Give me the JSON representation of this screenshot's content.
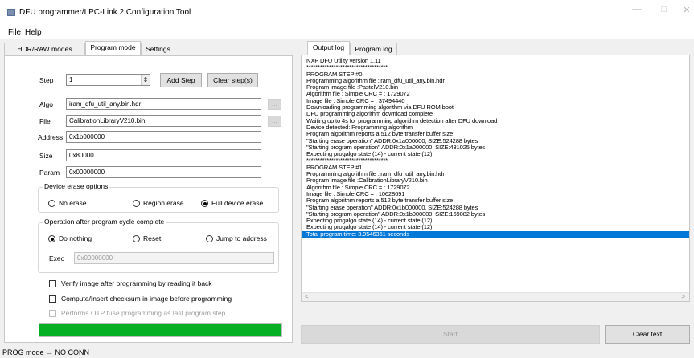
{
  "window": {
    "title": "DFU programmer/LPC-Link 2 Configuration Tool",
    "minimize": "—",
    "maximize": "□",
    "close": "✕"
  },
  "menu": [
    "File",
    "Help"
  ],
  "left_tabs": [
    "HDR/RAW modes",
    "Program mode",
    "Settings"
  ],
  "step": {
    "label": "Step",
    "value": "1",
    "spinner": "⇕",
    "add": "Add Step",
    "clear": "Clear step(s)"
  },
  "fields": {
    "algo": {
      "label": "Algo",
      "value": "iram_dfu_util_any.bin.hdr",
      "browse": "..."
    },
    "file": {
      "label": "File",
      "value": "CalibrationLibraryV210.bin",
      "browse": "..."
    },
    "address": {
      "label": "Address",
      "value": "0x1b000000"
    },
    "size": {
      "label": "Size",
      "value": "0x80000"
    },
    "param": {
      "label": "Param",
      "value": "0x00000000"
    }
  },
  "erase": {
    "title": "Device erase options",
    "options": [
      "No erase",
      "Region erase",
      "Full device erase"
    ],
    "selected": "Full device erase"
  },
  "after": {
    "title": "Operation after program cycle complete",
    "options": [
      "Do nothing",
      "Reset",
      "Jump to address"
    ],
    "selected": "Do nothing",
    "exec_label": "Exec",
    "exec_value": "0x00000000"
  },
  "checks": [
    "Verify image after programming by reading it back",
    "Compute/Insert checksum in image before programming",
    "Performs OTP fuse programming as last program step"
  ],
  "progress": 1.0,
  "progress_color": "#06b025",
  "right_tabs": [
    "Output log",
    "Program log"
  ],
  "log_lines": [
    "NXP DFU Utility version 1.11",
    "************************************",
    "PROGRAM STEP #0",
    "Programming algorithm file :iram_dfu_util_any.bin.hdr",
    "Program image file :PastelV210.bin",
    "Algorithm file : Simple CRC = : 1729072",
    "Image file : Simple CRC = : 37494440",
    "Downloading programming algorithm via DFU ROM boot",
    "DFU programming algorithm download complete",
    "Waiting up to 4s for programming algorithm detection after DFU download",
    "Device detected: Programming algorithm",
    "Program algorithm reports a 512 byte transfer buffer size",
    "\"Starting erase operation\" ADDR:0x1a000000, SIZE:524288 bytes",
    "\"Starting program operation\" ADDR:0x1a000000, SIZE:431025 bytes",
    "Expecting progalgo state (14) - current state (12)",
    "************************************",
    "PROGRAM STEP #1",
    "Programming algorithm file :iram_dfu_util_any.bin.hdr",
    "Program image file :CalibrationLibraryV210.bin",
    "Algorithm file : Simple CRC = : 1729072",
    "Image file : Simple CRC = : 10628691",
    "Program algorithm reports a 512 byte transfer buffer size",
    "\"Starting erase operation\" ADDR:0x1b000000, SIZE:524288 bytes",
    "\"Starting program operation\" ADDR:0x1b000000, SIZE:169082 bytes",
    "Expecting progalgo state (14) - current state (12)",
    "Expecting progalgo state (14) - current state (12)",
    "Total program time:  3.9546361 seconds"
  ],
  "scroll_left": "<",
  "scroll_right": ">",
  "buttons": {
    "start": "Start",
    "clear_text": "Clear text"
  },
  "status": "PROG mode  → NO CONN"
}
